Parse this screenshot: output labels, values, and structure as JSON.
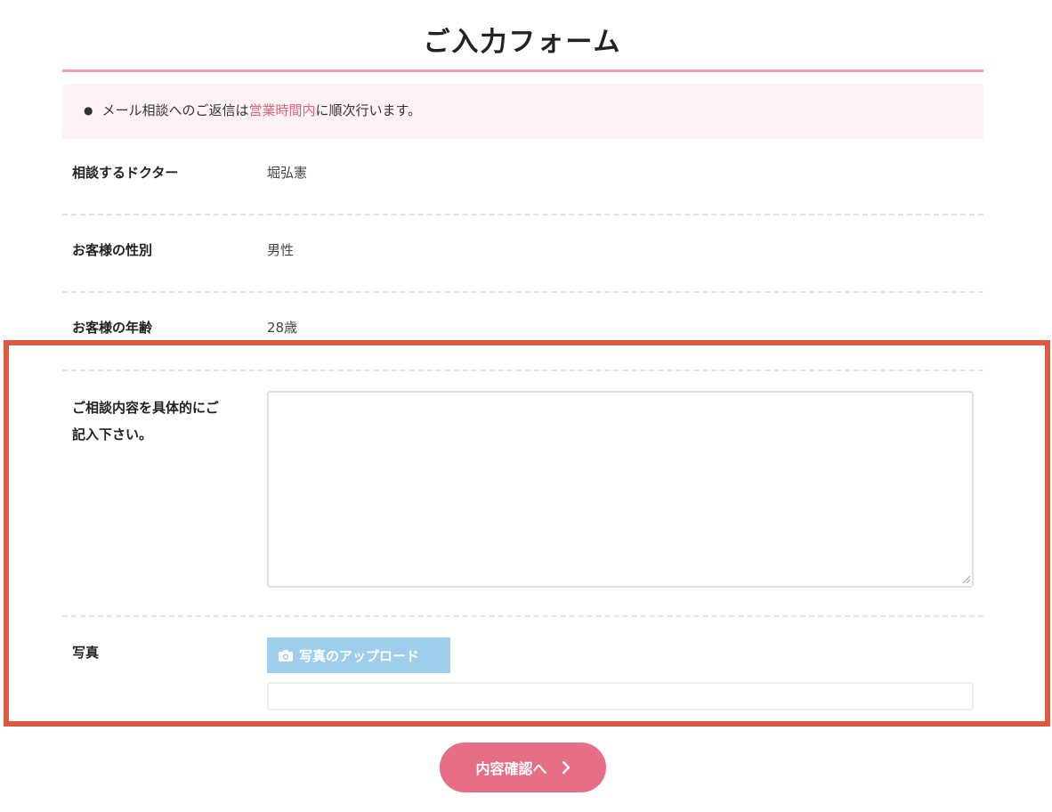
{
  "form": {
    "title": "ご入力フォーム"
  },
  "notice": {
    "text_before": "メール相談へのご返信は",
    "text_accent": "営業時間内",
    "text_after": "に順次行います。",
    "accent_color": "#e1637b"
  },
  "rows": {
    "doctor": {
      "label": "相談するドクター",
      "value": "堀弘憲"
    },
    "gender": {
      "label": "お客様の性別",
      "value": "男性"
    },
    "age": {
      "label": "お客様の年齢",
      "value": "28歳"
    }
  },
  "consultation": {
    "label_line1": "ご相談内容を具体的にご",
    "label_line2": "記入下さい。",
    "value": ""
  },
  "photo": {
    "label": "写真",
    "upload_label": "写真のアップロード",
    "upload_icon": "camera-icon",
    "file_value": ""
  },
  "submit": {
    "label": "内容確認へ",
    "icon": "chevron-right-icon"
  },
  "colors": {
    "title_rule": "#f0a0ae",
    "notice_bg": "#fdf3f4",
    "upload_button": "#9fcdec",
    "confirm_button": "#e66e85",
    "highlight_frame": "#dc5a42"
  }
}
